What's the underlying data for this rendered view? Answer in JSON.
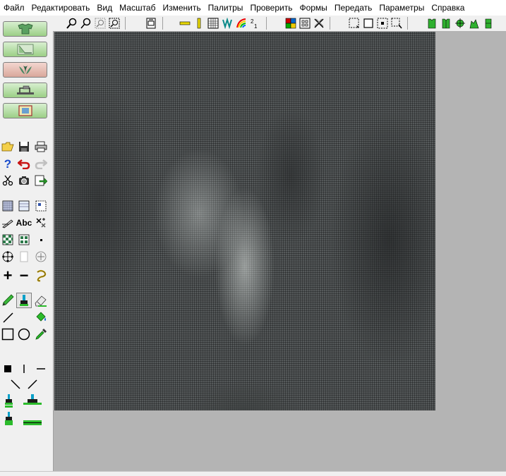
{
  "menu": {
    "items": [
      "Файл",
      "Редактировать",
      "Вид",
      "Масштаб",
      "Изменить",
      "Палитры",
      "Проверить",
      "Формы",
      "Передать",
      "Параметры",
      "Справка"
    ]
  },
  "toolbar": {
    "icons": [
      "zoom-in-icon",
      "zoom-out-icon",
      "zoom-region-icon",
      "zoom-fit-icon",
      "print-preview-icon",
      "grid-icon",
      "ruler-horizontal-icon",
      "ruler-vertical-icon",
      "stitch-view-icon",
      "palette-rainbow-icon",
      "color-count-icon",
      "palette-view-icon",
      "thread-symbols-icon",
      "needle-cross-icon",
      "select-rectangle-icon",
      "select-all-icon",
      "select-center-icon",
      "select-freeform-icon",
      "design-preview-1-icon",
      "design-preview-2-icon",
      "design-preview-3-icon",
      "design-preview-4-icon",
      "design-preview-5-icon"
    ]
  },
  "modes": [
    "garment-mode",
    "chart-mode",
    "symmetry-mode",
    "sewing-machine-mode",
    "frame-mode"
  ],
  "tools": {
    "text_tool": "Abc",
    "plus": "+",
    "minus": "−"
  },
  "colors": {
    "canvas_bg": "#b4b4b4",
    "pattern_bg": "#55595a",
    "mode_btn": "#9bcf86",
    "mode_btn_selected": "#d9a79b"
  }
}
